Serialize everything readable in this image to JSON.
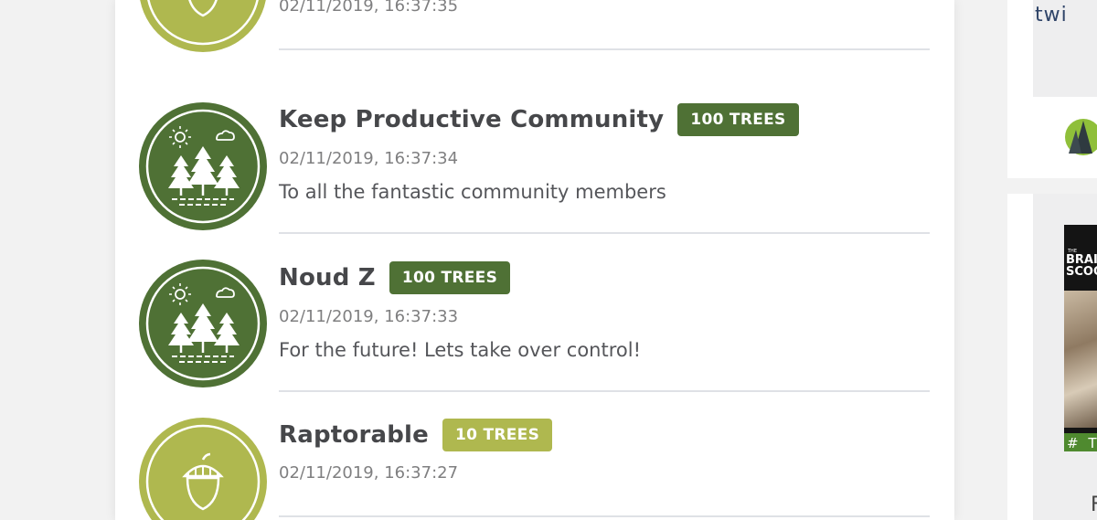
{
  "colors": {
    "forest_badge": "#4f7135",
    "acorn_badge": "#afb84f",
    "name_text": "#46474a",
    "muted_text": "#7f7f80"
  },
  "donations": [
    {
      "name": "",
      "trees_label": "",
      "timestamp": "02/11/2019, 16:37:35",
      "message": "",
      "badge_icon": "acorn-icon"
    },
    {
      "name": "Keep Productive Community",
      "trees_label": "100 TREES",
      "timestamp": "02/11/2019, 16:37:34",
      "message": "To all the fantastic community members",
      "badge_icon": "forest-icon"
    },
    {
      "name": "Noud Z",
      "trees_label": "100 TREES",
      "timestamp": "02/11/2019, 16:37:33",
      "message": "For the future! Lets take over control!",
      "badge_icon": "forest-icon"
    },
    {
      "name": "Raptorable",
      "trees_label": "10 TREES",
      "timestamp": "02/11/2019, 16:37:27",
      "message": "",
      "badge_icon": "acorn-icon"
    }
  ],
  "sidebar": {
    "twitter_text": "twi",
    "book": {
      "the": "THE",
      "title_line1": "BRAIN",
      "title_line2": "SCOOP",
      "hashtag": "# T"
    },
    "bottom_letter": "F"
  }
}
